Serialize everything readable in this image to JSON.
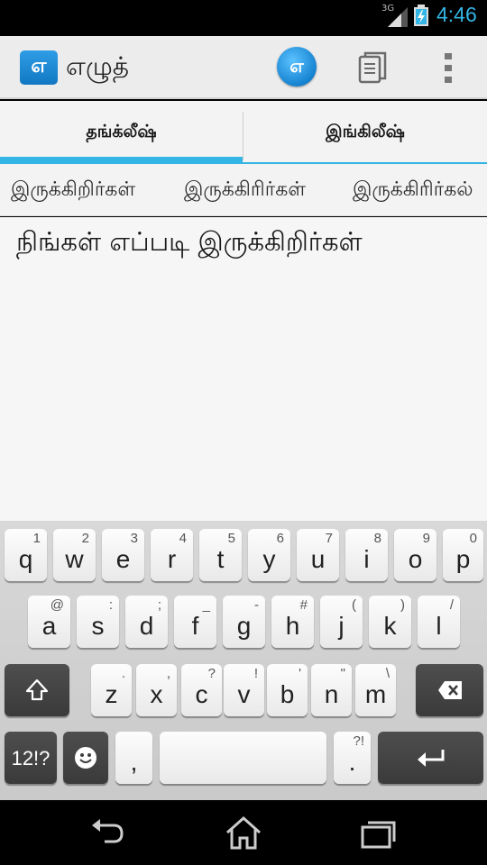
{
  "status_bar": {
    "network_label": "3G",
    "time": "4:46",
    "icons": [
      "signal-icon",
      "battery-charging-icon"
    ]
  },
  "app_bar": {
    "logo_text": "எ",
    "title": "எழுத்",
    "actions": [
      {
        "name": "tamil-mode-icon",
        "text": "எ"
      },
      {
        "name": "copy-icon"
      },
      {
        "name": "overflow-menu-icon"
      }
    ]
  },
  "tabs": [
    {
      "label": "தங்க்லீஷ்",
      "selected": true
    },
    {
      "label": "இங்கிலீஷ்",
      "selected": false
    }
  ],
  "suggestions": [
    "இருக்கிறிர்கள்",
    "இருக்கிரிர்கள்",
    "இருக்கிரிர்கல்"
  ],
  "editor": {
    "text": "நிங்கள் எப்படி இருக்கிறிர்கள்"
  },
  "keyboard": {
    "row1": [
      {
        "k": "q",
        "h": "1"
      },
      {
        "k": "w",
        "h": "2"
      },
      {
        "k": "e",
        "h": "3"
      },
      {
        "k": "r",
        "h": "4"
      },
      {
        "k": "t",
        "h": "5"
      },
      {
        "k": "y",
        "h": "6"
      },
      {
        "k": "u",
        "h": "7"
      },
      {
        "k": "i",
        "h": "8"
      },
      {
        "k": "o",
        "h": "9"
      },
      {
        "k": "p",
        "h": "0"
      }
    ],
    "row2": [
      {
        "k": "a",
        "h": "@"
      },
      {
        "k": "s",
        "h": ":"
      },
      {
        "k": "d",
        "h": ";"
      },
      {
        "k": "f",
        "h": "_"
      },
      {
        "k": "g",
        "h": "-"
      },
      {
        "k": "h",
        "h": "#"
      },
      {
        "k": "j",
        "h": "("
      },
      {
        "k": "k",
        "h": ")"
      },
      {
        "k": "l",
        "h": "/"
      }
    ],
    "row3": [
      {
        "k": "z",
        "h": "."
      },
      {
        "k": "x",
        "h": ","
      },
      {
        "k": "c",
        "h": "?"
      },
      {
        "k": "v",
        "h": "!"
      },
      {
        "k": "b",
        "h": "'"
      },
      {
        "k": "n",
        "h": "\""
      },
      {
        "k": "m",
        "h": "\\"
      }
    ],
    "symbols_label": "12!?",
    "comma": ",",
    "period": ".",
    "period_hint": "?!",
    "icons": [
      "shift-icon",
      "backspace-icon",
      "emoji-icon",
      "enter-icon"
    ]
  },
  "nav_bar": {
    "icons": [
      "back-icon",
      "home-icon",
      "recents-icon"
    ]
  }
}
